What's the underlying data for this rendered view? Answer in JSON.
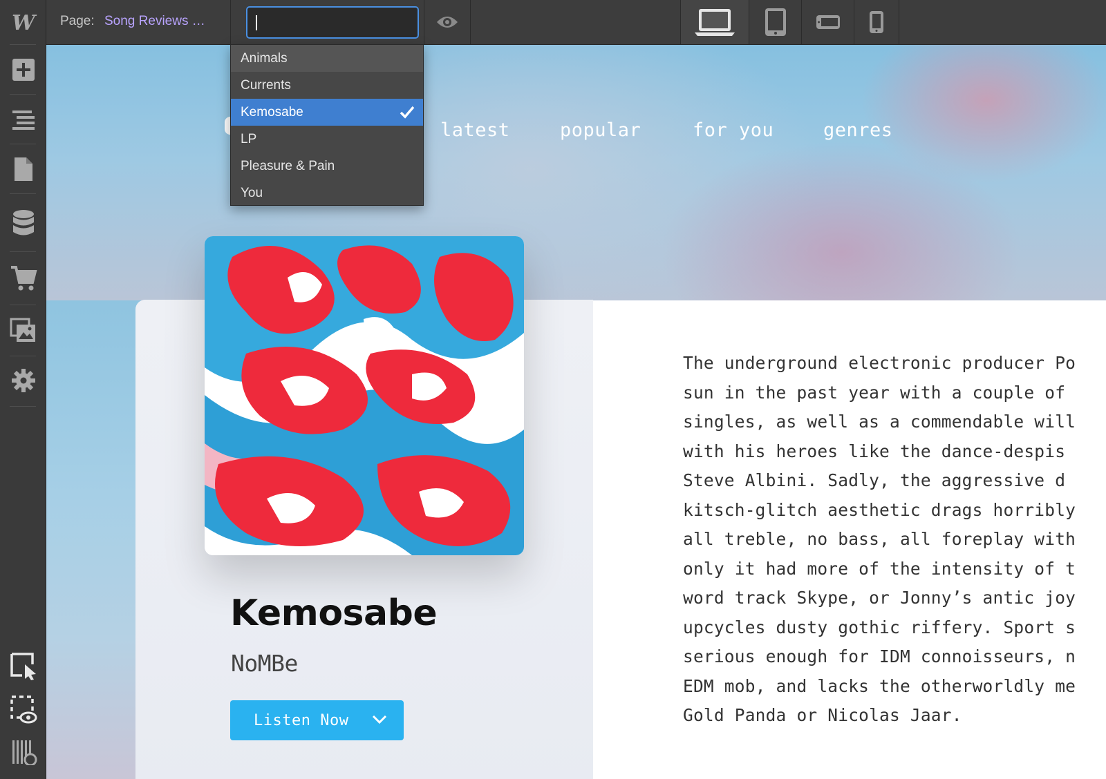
{
  "topbar": {
    "page_label": "Page:",
    "page_name": "Song Reviews …",
    "search_value": "",
    "devices": [
      "desktop",
      "tablet",
      "mobile-landscape",
      "mobile-portrait"
    ]
  },
  "dropdown": {
    "options": [
      "Animals",
      "Currents",
      "Kemosabe",
      "LP",
      "Pleasure & Pain",
      "You"
    ],
    "hovered": "Animals",
    "selected": "Kemosabe"
  },
  "sidebar": {
    "icons": [
      "webflow-logo-icon",
      "add-icon",
      "navigator-icon",
      "pages-icon",
      "cms-icon",
      "ecommerce-icon",
      "assets-icon",
      "settings-icon",
      "select-icon",
      "preview-icon",
      "audit-icon"
    ]
  },
  "site": {
    "nav": [
      "latest",
      "popular",
      "for you",
      "genres"
    ],
    "song_title": "Kemosabe",
    "artist": "NoMBe",
    "listen_label": "Listen Now",
    "review_lines": [
      "The underground electronic producer Po",
      "sun in the past year with a couple of",
      "singles, as well as a commendable will",
      "with his heroes like the dance-despis",
      "Steve Albini. Sadly, the aggressive d",
      "kitsch-glitch aesthetic drags horribly",
      "all treble, no bass, all foreplay with",
      "only it had more of the intensity of t",
      "word track Skype, or Jonny’s antic joy",
      "upcycles dusty gothic riffery. Sport s",
      "serious enough for IDM connoisseurs, n",
      "EDM mob, and lacks the otherworldly me",
      "Gold Panda or Nicolas Jaar."
    ]
  },
  "colors": {
    "accent": "#4a90e2",
    "selected_item": "#3f7fd0",
    "page_name": "#b9a4ff",
    "listen_button": "#2ab2f0"
  }
}
